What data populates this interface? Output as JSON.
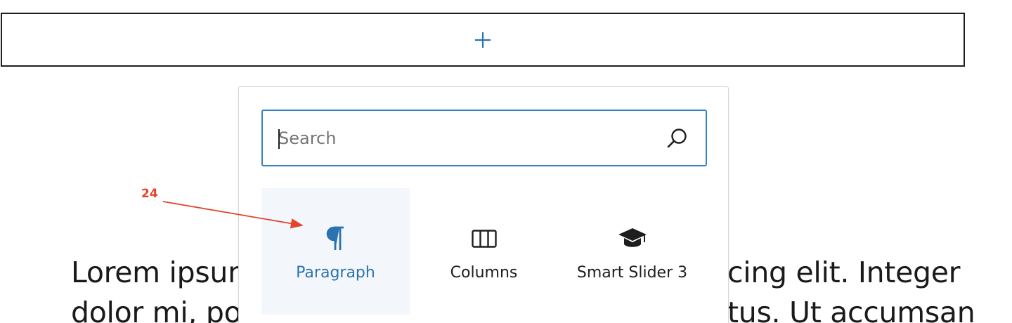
{
  "appender": {
    "icon": "plus-icon",
    "icon_color": "#2c72b0"
  },
  "background_text": {
    "line1_left": "Lorem ipsum",
    "line1_right": "cing elit. Integer",
    "line2_left": "dolor mi, por",
    "line2_right": "tus. Ut accumsan"
  },
  "inserter": {
    "search": {
      "placeholder": "Search",
      "value": "",
      "icon": "search-icon"
    },
    "blocks": [
      {
        "label": "Paragraph",
        "icon": "paragraph-icon",
        "selected": true
      },
      {
        "label": "Columns",
        "icon": "columns-icon",
        "selected": false
      },
      {
        "label": "Smart Slider 3",
        "icon": "graduation-cap-icon",
        "selected": false
      }
    ]
  },
  "annotation": {
    "label": "24",
    "color": "#e2452c"
  },
  "colors": {
    "accent": "#2c72b0",
    "focus_border": "#3582c4",
    "selected_bg": "#f3f7fb",
    "border_dark": "#1e1e1e"
  }
}
